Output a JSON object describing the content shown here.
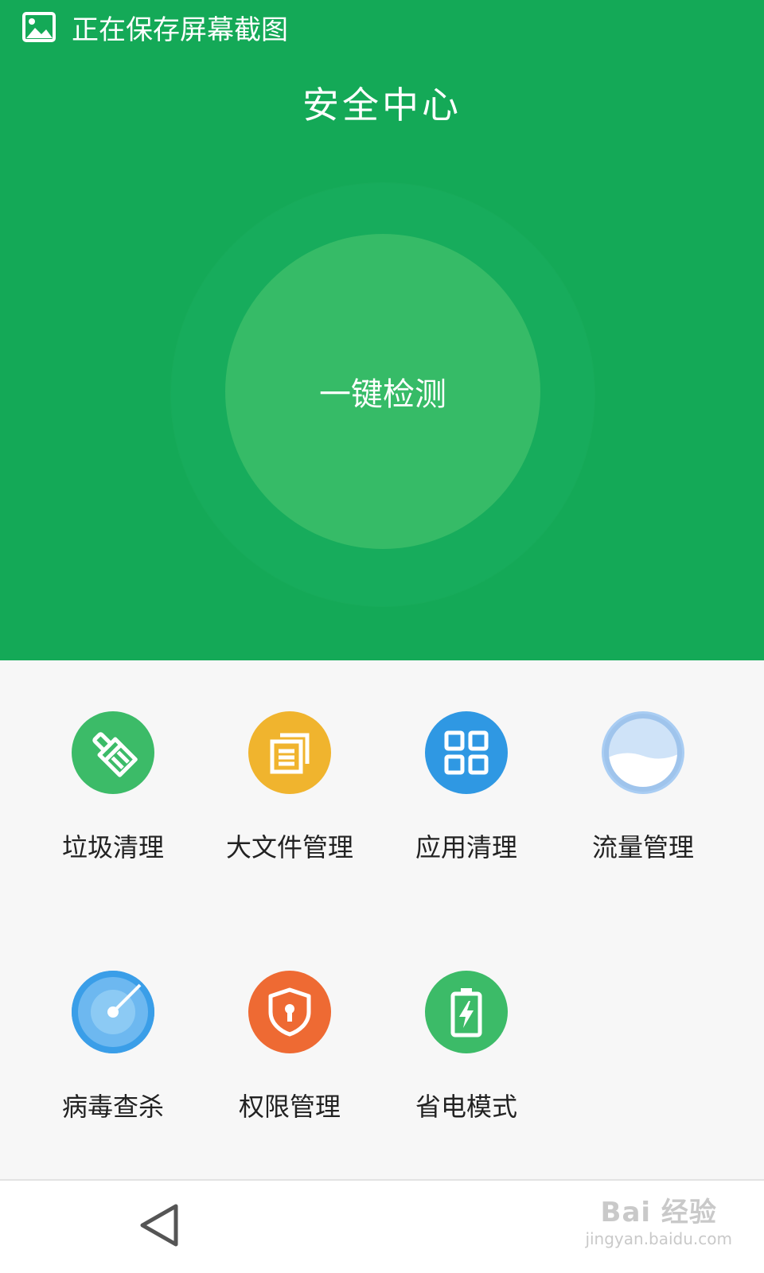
{
  "status_bar": {
    "notification_text": "正在保存屏幕截图",
    "icon": "image-icon"
  },
  "header": {
    "title": "安全中心",
    "scan_button_label": "一键检测"
  },
  "tools": [
    {
      "label": "垃圾清理",
      "icon": "broom-icon",
      "color": "#3cbb68"
    },
    {
      "label": "大文件管理",
      "icon": "documents-icon",
      "color": "#f0b42e"
    },
    {
      "label": "应用清理",
      "icon": "app-grid-icon",
      "color": "#2f98e3"
    },
    {
      "label": "流量管理",
      "icon": "data-usage-icon",
      "color": "#a9cdf3"
    },
    {
      "label": "病毒查杀",
      "icon": "radar-icon",
      "color": "#3a9ee8"
    },
    {
      "label": "权限管理",
      "icon": "shield-lock-icon",
      "color": "#ee6a33"
    },
    {
      "label": "省电模式",
      "icon": "battery-charging-icon",
      "color": "#3cbb68"
    }
  ],
  "navbar": {
    "back_icon": "back-triangle-icon"
  },
  "watermark": {
    "main": "Bai 经验",
    "sub": "jingyan.baidu.com"
  },
  "colors": {
    "header_green": "#14a957",
    "ring_green": "#17ac5c",
    "button_green": "#36bb67",
    "page_bg": "#f7f7f7"
  }
}
